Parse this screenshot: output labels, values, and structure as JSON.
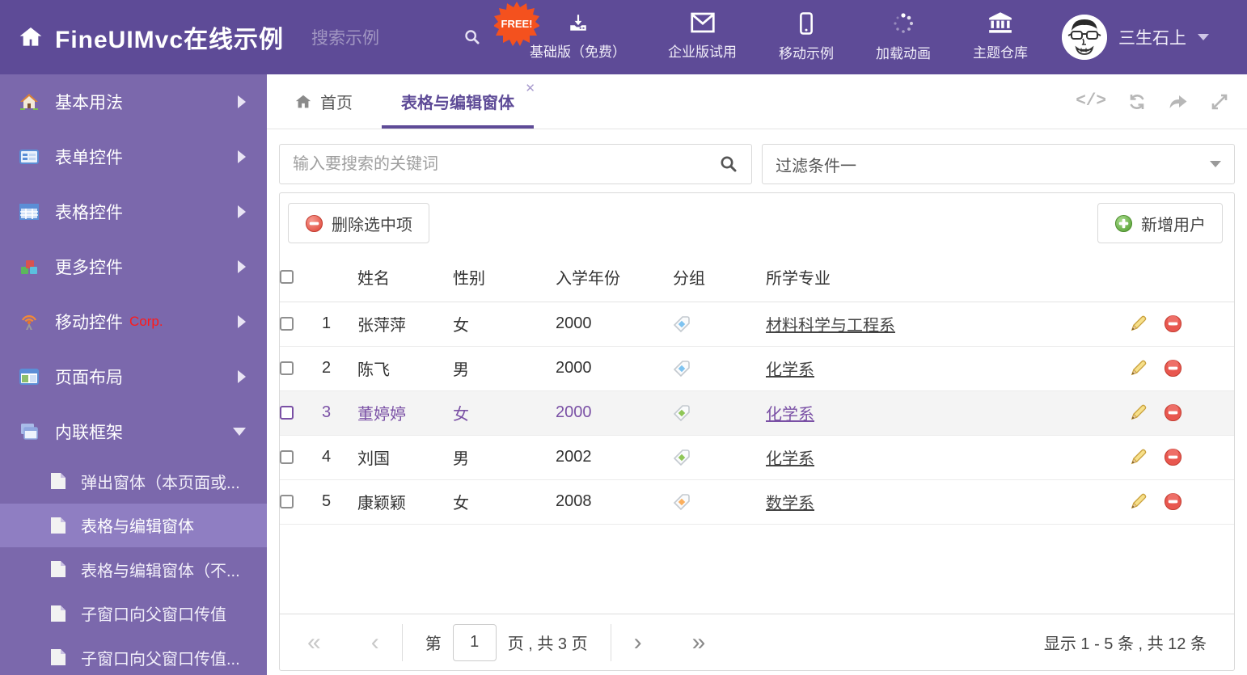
{
  "colors": {
    "header_bg": "#5e4b97",
    "sidebar_bg": "#7b68ac",
    "sidebar_selected_bg": "#8f7ec2",
    "accent_purple": "#5e4b97",
    "selected_row_text": "#7a50a5",
    "free_badge": "#f4511e",
    "delete_red": "#e05348",
    "add_green": "#6cb04a",
    "tags": {
      "blue": "#7ec3f0",
      "green": "#8fc657",
      "orange": "#fbaf5d"
    }
  },
  "header": {
    "title": "FineUIMvc在线示例",
    "search_placeholder": "搜索示例",
    "free_badge": "FREE!",
    "nav_items": [
      {
        "label": "基础版（免费）",
        "icon": "download-icon"
      },
      {
        "label": "企业版试用",
        "icon": "envelope-icon"
      },
      {
        "label": "移动示例",
        "icon": "mobile-icon"
      },
      {
        "label": "加载动画",
        "icon": "spinner-icon"
      },
      {
        "label": "主题仓库",
        "icon": "bank-icon"
      }
    ],
    "user": {
      "name": "三生石上"
    }
  },
  "sidebar": {
    "items": [
      {
        "label": "基本用法",
        "icon": "home-icon"
      },
      {
        "label": "表单控件",
        "icon": "form-icon"
      },
      {
        "label": "表格控件",
        "icon": "table-icon"
      },
      {
        "label": "更多控件",
        "icon": "cubes-icon"
      },
      {
        "label": "移动控件",
        "badge": "Corp.",
        "icon": "antenna-icon"
      },
      {
        "label": "页面布局",
        "icon": "layout-icon"
      },
      {
        "label": "内联框架",
        "icon": "frames-icon"
      }
    ],
    "subitems": [
      {
        "label": "弹出窗体（本页面或..."
      },
      {
        "label": "表格与编辑窗体",
        "selected": true
      },
      {
        "label": "表格与编辑窗体（不..."
      },
      {
        "label": "子窗口向父窗口传值"
      },
      {
        "label": "子窗口向父窗口传值..."
      }
    ]
  },
  "tabs": {
    "home": "首页",
    "active": "表格与编辑窗体"
  },
  "filters": {
    "search_placeholder": "输入要搜索的关键词",
    "filter_value": "过滤条件一"
  },
  "toolbar": {
    "delete_label": "删除选中项",
    "add_label": "新增用户"
  },
  "table": {
    "headers": {
      "name": "姓名",
      "gender": "性别",
      "year": "入学年份",
      "group": "分组",
      "major": "所学专业"
    },
    "rows": [
      {
        "num": "1",
        "name": "张萍萍",
        "gender": "女",
        "year": "2000",
        "tag": "blue",
        "major": "材料科学与工程系",
        "selected": false
      },
      {
        "num": "2",
        "name": "陈飞",
        "gender": "男",
        "year": "2000",
        "tag": "blue",
        "major": "化学系",
        "selected": false
      },
      {
        "num": "3",
        "name": "董婷婷",
        "gender": "女",
        "year": "2000",
        "tag": "green",
        "major": "化学系",
        "selected": true
      },
      {
        "num": "4",
        "name": "刘国",
        "gender": "男",
        "year": "2002",
        "tag": "green",
        "major": "化学系",
        "selected": false
      },
      {
        "num": "5",
        "name": "康颖颖",
        "gender": "女",
        "year": "2008",
        "tag": "orange",
        "major": "数学系",
        "selected": false
      }
    ]
  },
  "pagination": {
    "prefix": "第",
    "page_value": "1",
    "suffix": "页 , 共 3 页",
    "summary": "显示 1 - 5 条 , 共 12 条"
  }
}
